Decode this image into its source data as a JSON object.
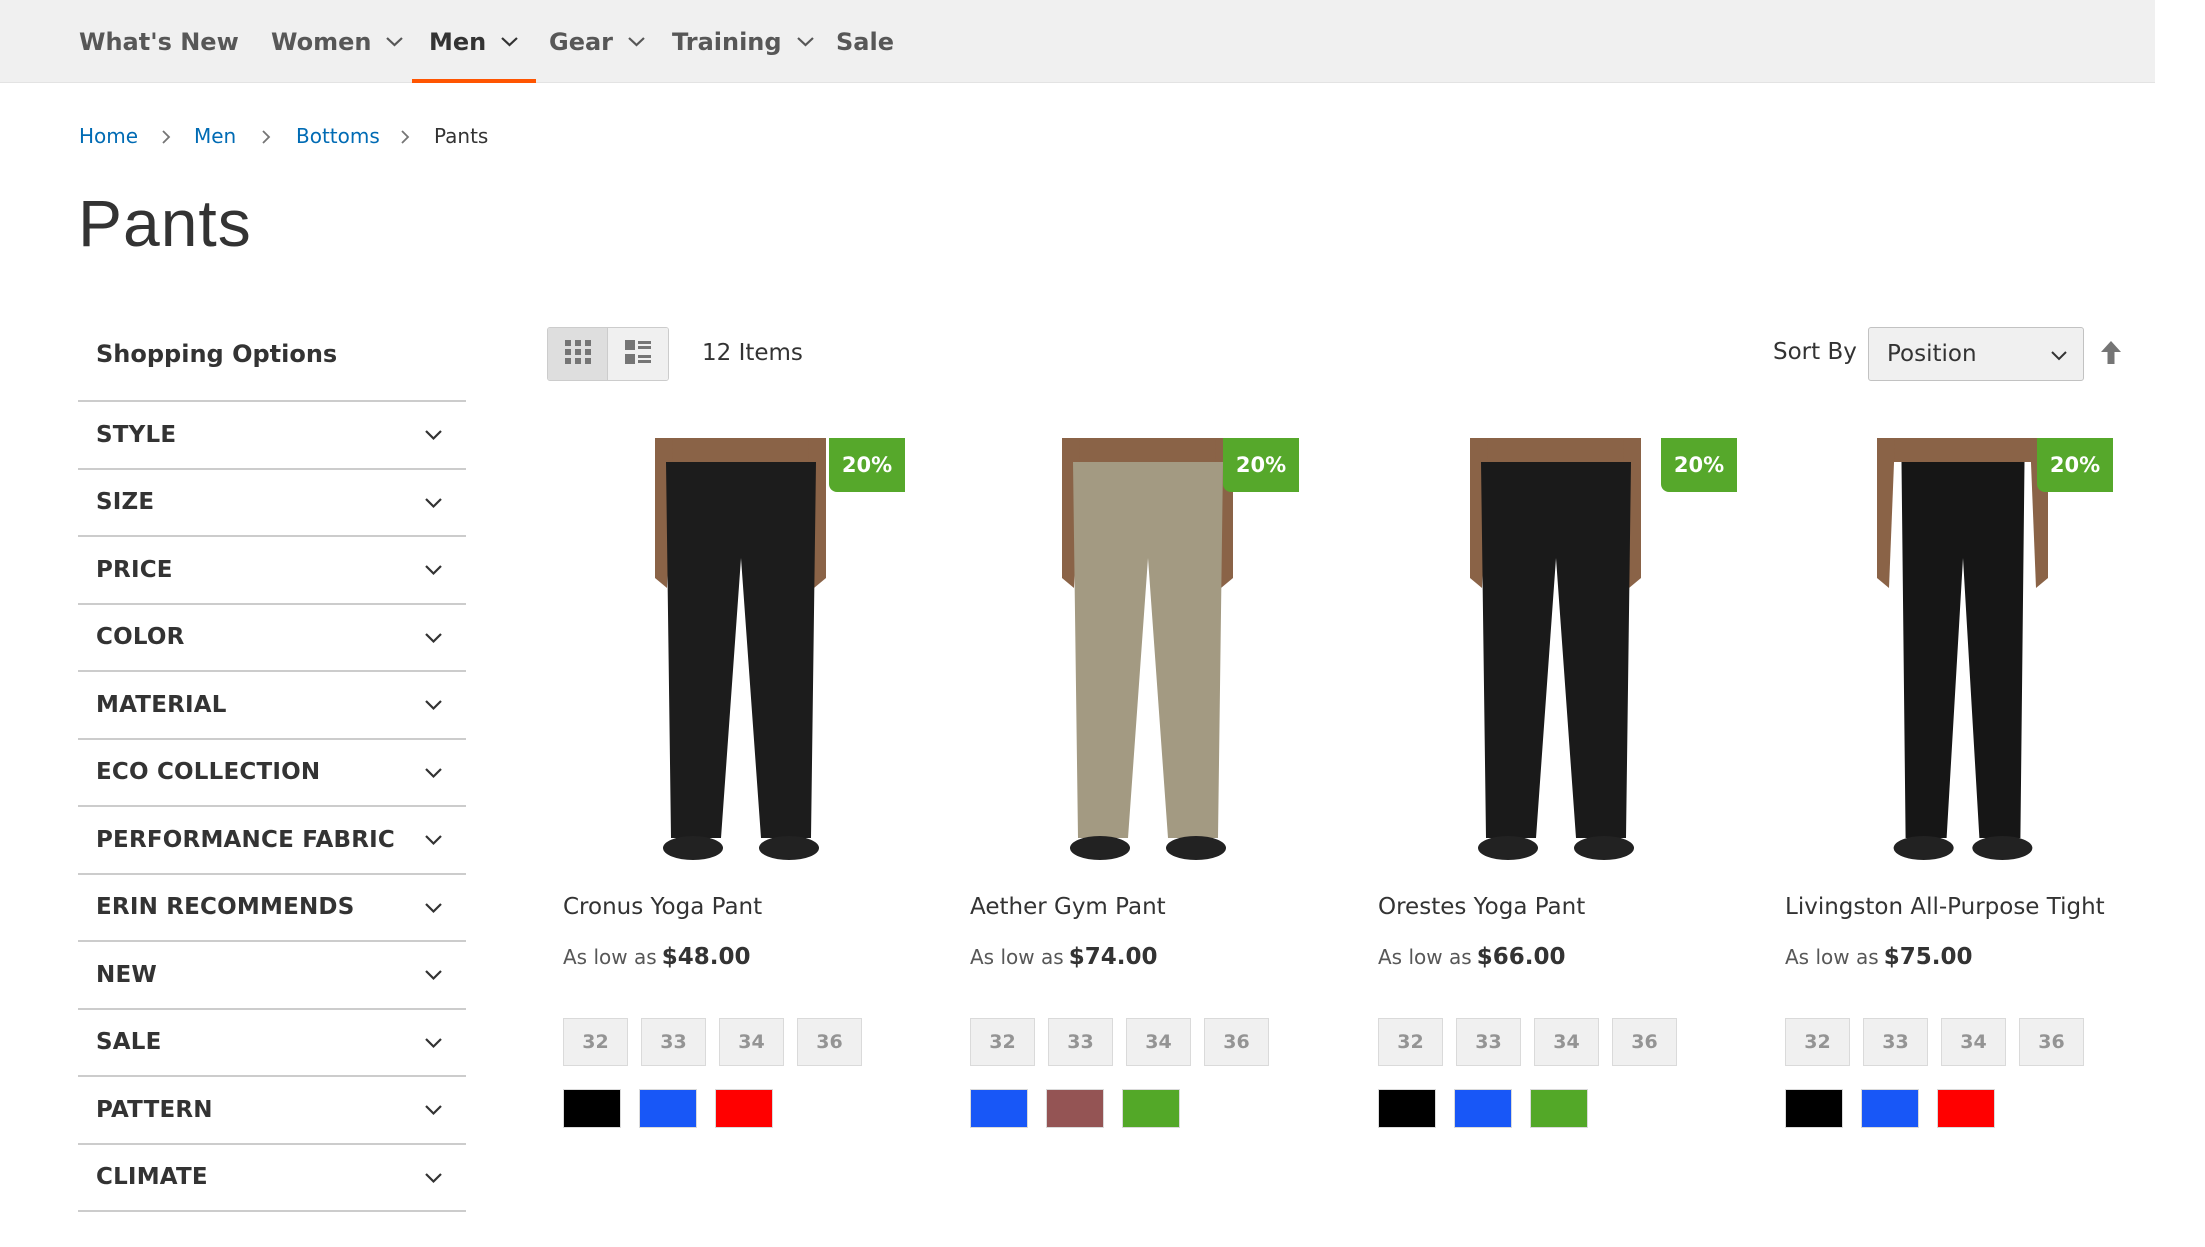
{
  "nav": {
    "items": [
      {
        "label": "What's New",
        "dropdown": false,
        "active": false
      },
      {
        "label": "Women",
        "dropdown": true,
        "active": false
      },
      {
        "label": "Men",
        "dropdown": true,
        "active": true
      },
      {
        "label": "Gear",
        "dropdown": true,
        "active": false
      },
      {
        "label": "Training",
        "dropdown": true,
        "active": false
      },
      {
        "label": "Sale",
        "dropdown": false,
        "active": false
      }
    ],
    "active_accent": "#ff5501"
  },
  "breadcrumbs": [
    "Home",
    "Men",
    "Bottoms",
    "Pants"
  ],
  "page_title": "Pants",
  "sidebar": {
    "heading": "Shopping Options",
    "filters": [
      "STYLE",
      "SIZE",
      "PRICE",
      "COLOR",
      "MATERIAL",
      "ECO COLLECTION",
      "PERFORMANCE FABRIC",
      "ERIN RECOMMENDS",
      "NEW",
      "SALE",
      "PATTERN",
      "CLIMATE"
    ],
    "filter_icon": "chevron-down-icon"
  },
  "toolbar": {
    "view_modes": [
      "grid-view-icon",
      "list-view-icon"
    ],
    "active_view": "grid",
    "items_count": "12 Items",
    "sort_label": "Sort By",
    "sort_value": "Position",
    "sort_direction_icon": "arrow-up-icon"
  },
  "products": [
    {
      "name": "Cronus Yoga Pant",
      "price_prefix": "As low as",
      "price": "$48.00",
      "badge": "20%",
      "sizes": [
        "32",
        "33",
        "34",
        "36"
      ],
      "colors": [
        "#000000",
        "#1857f7",
        "#ff0000"
      ],
      "pant_color": "#1c1c1c"
    },
    {
      "name": "Aether Gym Pant",
      "price_prefix": "As low as",
      "price": "$74.00",
      "badge": "20%",
      "sizes": [
        "32",
        "33",
        "34",
        "36"
      ],
      "colors": [
        "#1857f7",
        "#945454",
        "#53a828"
      ],
      "pant_color": "#a39a82"
    },
    {
      "name": "Orestes Yoga Pant",
      "price_prefix": "As low as",
      "price": "$66.00",
      "badge": "20%",
      "sizes": [
        "32",
        "33",
        "34",
        "36"
      ],
      "colors": [
        "#000000",
        "#1857f7",
        "#53a828"
      ],
      "pant_color": "#1a1a1a"
    },
    {
      "name": "Livingston All-Purpose Tight",
      "price_prefix": "As low as",
      "price": "$75.00",
      "badge": "20%",
      "sizes": [
        "32",
        "33",
        "34",
        "36"
      ],
      "colors": [
        "#000000",
        "#1857f7",
        "#ff0000"
      ],
      "pant_color": "#161616"
    }
  ],
  "badge_color": "#56a82b",
  "link_color": "#006bb4"
}
